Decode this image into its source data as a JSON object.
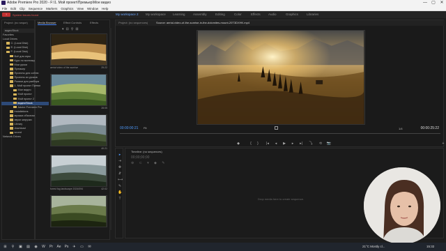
{
  "window": {
    "title": "Adobe Premiere Pro 2020 - F:\\1. Мой проект\\Премьер\\Мое видео",
    "min": "—",
    "max": "▢",
    "close": "✕"
  },
  "menu": [
    "File",
    "Edit",
    "Clip",
    "Sequence",
    "Markers",
    "Graphics",
    "View",
    "Window",
    "Help"
  ],
  "workspace": {
    "warning": "System Issues found",
    "tabs": [
      "My workspace 2",
      "My workspace",
      "Learning",
      "Assembly",
      "Editing",
      "Color",
      "Effects",
      "Audio",
      "Graphics",
      "Libraries"
    ],
    "active_index": 0
  },
  "project_panel": {
    "tab": "Project: (no seque)",
    "tabs": [
      "Project: (no seque)",
      "Media Browser",
      "Effect Controls",
      "Effects"
    ],
    "search_placeholder": "видео/Stock",
    "tree": [
      {
        "label": "Favorites",
        "indent": 0
      },
      {
        "label": "Local Drives",
        "indent": 0
      },
      {
        "label": "C: (Local Disk)",
        "indent": 1
      },
      {
        "label": "E: (Local Disk)",
        "indent": 1
      },
      {
        "label": "F: (Local Disk)",
        "indent": 1
      },
      {
        "label": "Всё для игры",
        "indent": 2
      },
      {
        "label": "Курс по монтажу",
        "indent": 2
      },
      {
        "label": "Мои уроки",
        "indent": 2
      },
      {
        "label": "Премьер",
        "indent": 2
      },
      {
        "label": "Проекты для соблю",
        "indent": 2
      },
      {
        "label": "Проекты из уроков",
        "indent": 2
      },
      {
        "label": "Ролики для разбора",
        "indent": 2
      },
      {
        "label": "1. Мой проект Преми",
        "indent": 2
      },
      {
        "label": "Мое видео",
        "indent": 3
      },
      {
        "label": "Мой проект",
        "indent": 3
      },
      {
        "label": "Мой проект 2",
        "indent": 3
      },
      {
        "label": "видео/Stock",
        "indent": 3,
        "selected": true
      },
      {
        "label": "Adobe Premiere Pro",
        "indent": 3
      },
      {
        "label": "Installations",
        "indent": 2
      },
      {
        "label": "музыка обычная",
        "indent": 2
      },
      {
        "label": "звуки загрузки",
        "indent": 2
      },
      {
        "label": "Library",
        "indent": 2
      },
      {
        "label": "download",
        "indent": 2
      },
      {
        "label": "sound",
        "indent": 2
      },
      {
        "label": "Network Drives",
        "indent": 0
      }
    ]
  },
  "media": [
    {
      "caption": "aerial video of the sunrise",
      "duration": "25:22",
      "palette": "sunrise"
    },
    {
      "caption": "",
      "duration": "28:05",
      "palette": "hills"
    },
    {
      "caption": "",
      "duration": "40:21",
      "palette": "mountains"
    },
    {
      "caption": "forest fog landscape 2024/094",
      "duration": "42:02",
      "palette": "fog"
    },
    {
      "caption": "",
      "duration": "",
      "palette": "wheat"
    }
  ],
  "monitor": {
    "tabs": [
      "Project: (no sequences)",
      "Source: aerial-video-of-the-sunrise-in-the-dolomites-mount-20T3DXHK.mp4"
    ],
    "timecode_left": "00:00:00:21",
    "fit": "Fit",
    "fraction": "1/4",
    "timecode_right": "00:00:25:22",
    "controls": [
      "◆",
      "{",
      "}",
      "|◂",
      "◂",
      "▶",
      "▸",
      "▸|",
      "⤵",
      "⟲",
      "📷",
      "+"
    ]
  },
  "timeline": {
    "title": "Timeline: (no sequences)",
    "timecode": "00;00;00;00",
    "drop_hint": "Drop media here to create sequence."
  },
  "tools": [
    "▸",
    "⇥",
    "✥",
    "⇵",
    "⟷",
    "✎",
    "✋",
    "T"
  ],
  "taskbar": {
    "weather": "21°C Mostly cl...",
    "time": "15:32",
    "icons": [
      "start-icon",
      "search-icon",
      "taskview-icon",
      "explorer-icon",
      "chrome-icon",
      "word-icon",
      "premiere-icon",
      "aftereffects-icon",
      "photoshop-icon",
      "telegram-icon",
      "folder-icon",
      "mail-icon"
    ]
  }
}
